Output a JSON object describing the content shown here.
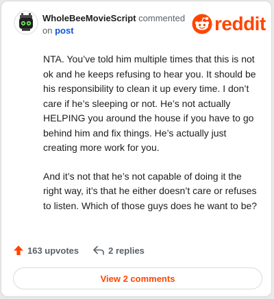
{
  "comment": {
    "username": "WholeBeeMovieScript",
    "action_text": "commented",
    "on_text": "on",
    "post_link": "post",
    "paragraphs": [
      "NTA. You’ve told him multiple times that this is not ok and he keeps refusing to hear you. It should be his responsibility to clean it up every time. I don’t care if he’s sleeping or not. He’s not actually HELPING you around the house if you have to go behind him and fix things. He’s actually just creating more work for you.",
      "And it’s not that he’s not capable of doing it the right way, it’s that he either doesn’t care or refuses to listen. Which of those guys does he want to be?"
    ]
  },
  "brand": {
    "wordmark": "reddit",
    "accent_color": "#ff4500"
  },
  "actions": {
    "upvotes_label": "163 upvotes",
    "replies_label": "2 replies",
    "upvote_icon": "arrow-up-icon",
    "reply_icon": "reply-arrow-icon"
  },
  "footer": {
    "view_comments_label": "View 2 comments"
  }
}
